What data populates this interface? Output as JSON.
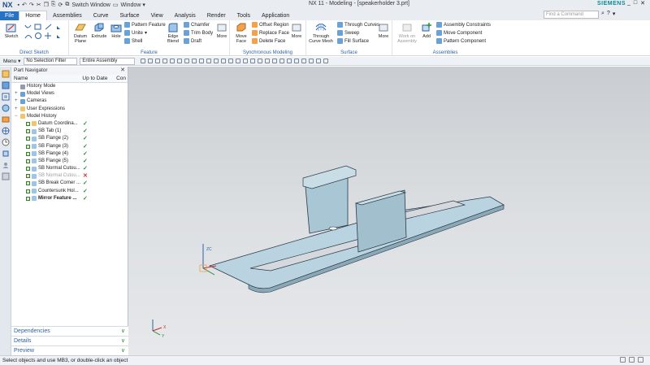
{
  "titlebar": {
    "logo": "NX",
    "switch_window": "Switch Window",
    "window_menu": "Window ▾",
    "title": "NX 11 - Modeling - [speakerholder 3.prt]",
    "brand": "SIEMENS",
    "win_controls": [
      "_",
      "□",
      "✕"
    ]
  },
  "menu": {
    "tabs": [
      "File",
      "Home",
      "Assemblies",
      "Curve",
      "Surface",
      "View",
      "Analysis",
      "Render",
      "Tools",
      "Application"
    ],
    "active": "Home",
    "find_placeholder": "Find a Command"
  },
  "ribbon": {
    "direct_sketch": {
      "label": "Direct Sketch",
      "sketch": "Sketch"
    },
    "feature": {
      "label": "Feature",
      "datum_plane": "Datum Plane",
      "extrude": "Extrude",
      "hole": "Hole",
      "pattern_feature": "Pattern Feature",
      "unite": "Unite",
      "shell": "Shell",
      "edge_blend": "Edge Blend",
      "chamfer": "Chamfer",
      "trim_body": "Trim Body",
      "draft": "Draft",
      "more": "More"
    },
    "synchronous": {
      "label": "Synchronous Modeling",
      "move_face": "Move Face",
      "offset_region": "Offset Region",
      "replace_face": "Replace Face",
      "delete_face": "Delete Face",
      "more": "More"
    },
    "surface": {
      "label": "Surface",
      "through_curve_mesh": "Through Curve Mesh",
      "through_curves": "Through Curves",
      "sweep": "Sweep",
      "fill_surface": "Fill Surface",
      "more": "More"
    },
    "assemblies": {
      "label": "Assemblies",
      "work_on_assembly": "Work on Assembly",
      "add": "Add",
      "assembly_constraints": "Assembly Constraints",
      "move_component": "Move Component",
      "pattern_component": "Pattern Component"
    }
  },
  "selbar": {
    "menu": "Menu ▾",
    "filter": "No Selection Filter",
    "scope": "Entire Assembly"
  },
  "navigator": {
    "title": "Part Navigator",
    "columns": [
      "Name",
      "Up to Date",
      "Con"
    ],
    "rows": [
      {
        "label": "History Mode",
        "indent": 0,
        "icon": "history-icon",
        "status": ""
      },
      {
        "label": "Model Views",
        "indent": 0,
        "icon": "model-views-icon",
        "status": ""
      },
      {
        "label": "Cameras",
        "indent": 0,
        "icon": "camera-icon",
        "status": ""
      },
      {
        "label": "User Expressions",
        "indent": 0,
        "icon": "folder-icon",
        "status": ""
      },
      {
        "label": "Model History",
        "indent": 0,
        "icon": "folder-icon",
        "status": ""
      },
      {
        "label": "Datum Coordina...",
        "indent": 1,
        "icon": "datum-icon",
        "status": "ok"
      },
      {
        "label": "SB Tab (1)",
        "indent": 1,
        "icon": "sheetmetal-icon",
        "status": "ok"
      },
      {
        "label": "SB Flange (2)",
        "indent": 1,
        "icon": "sheetmetal-icon",
        "status": "ok"
      },
      {
        "label": "SB Flange (3)",
        "indent": 1,
        "icon": "sheetmetal-icon",
        "status": "ok"
      },
      {
        "label": "SB Flange (4)",
        "indent": 1,
        "icon": "sheetmetal-icon",
        "status": "ok"
      },
      {
        "label": "SB Flange (5)",
        "indent": 1,
        "icon": "sheetmetal-icon",
        "status": "ok"
      },
      {
        "label": "SB Normal Cutou...",
        "indent": 1,
        "icon": "sheetmetal-icon",
        "status": "ok"
      },
      {
        "label": "SB Normal Cutou...",
        "indent": 1,
        "icon": "sheetmetal-icon",
        "status": "error"
      },
      {
        "label": "SB Break Corner ...",
        "indent": 1,
        "icon": "sheetmetal-icon",
        "status": "ok"
      },
      {
        "label": "Countersunk Hol...",
        "indent": 1,
        "icon": "hole-icon",
        "status": "ok"
      },
      {
        "label": "Mirror Feature ...",
        "indent": 1,
        "icon": "mirror-icon",
        "status": "ok"
      }
    ],
    "panels": [
      "Dependencies",
      "Details",
      "Preview"
    ]
  },
  "viewport": {
    "triad_labels": {
      "x": "X",
      "y": "Y",
      "z": "ZC"
    }
  },
  "status": {
    "message": "Select objects and use MB3, or double-click an object"
  }
}
